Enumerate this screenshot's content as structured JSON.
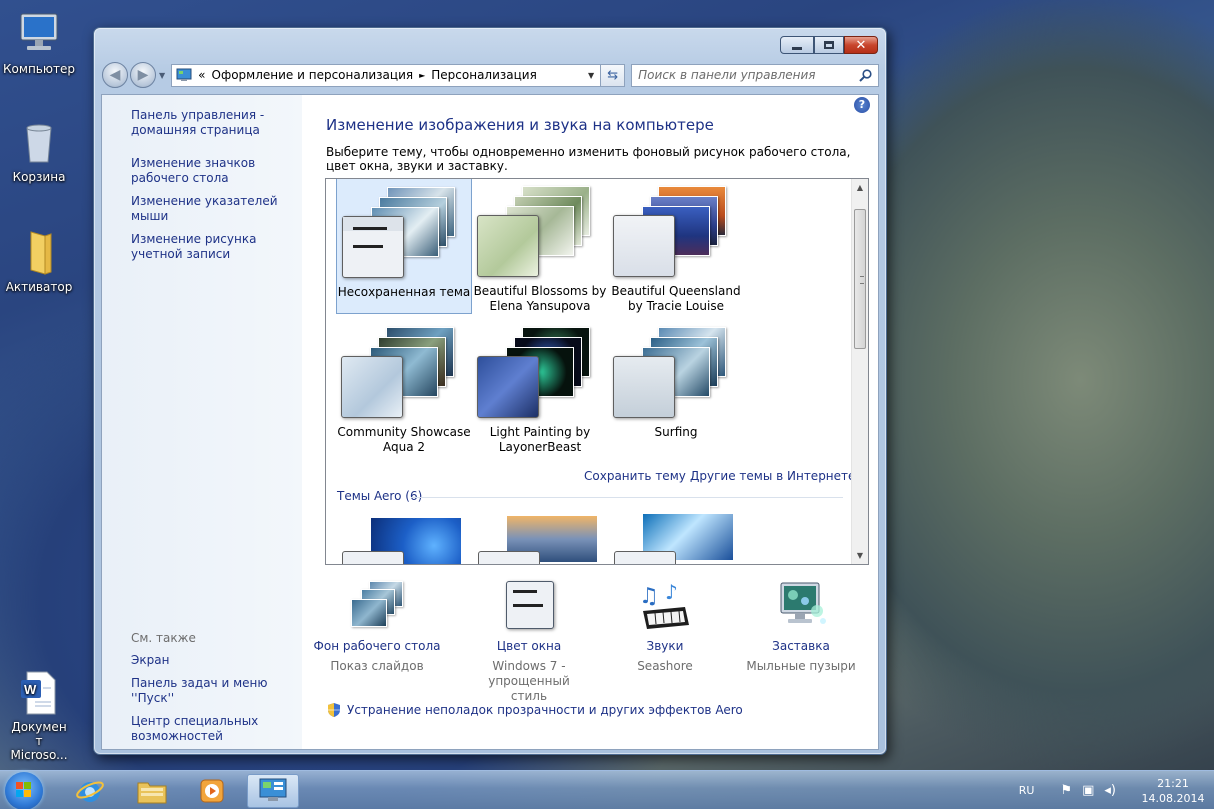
{
  "desktop": {
    "icons": [
      {
        "label": "Компьютер"
      },
      {
        "label": "Корзина"
      },
      {
        "label": "Активатор"
      },
      {
        "label": "Документ Microso..."
      }
    ]
  },
  "window": {
    "address": {
      "crumb_prefix": "«",
      "segment1": "Оформление и персонализация",
      "sep": "►",
      "segment2": "Персонализация"
    },
    "search_placeholder": "Поиск в панели управления",
    "left_pane": {
      "links": [
        "Панель управления - домашняя страница",
        "Изменение значков рабочего стола",
        "Изменение указателей мыши",
        "Изменение рисунка учетной записи"
      ],
      "see_also_header": "См. также",
      "see_also": [
        "Экран",
        "Панель задач и меню ''Пуск''",
        "Центр специальных возможностей"
      ]
    },
    "main": {
      "title": "Изменение изображения и звука на компьютере",
      "description": "Выберите тему, чтобы одновременно изменить фоновый рисунок рабочего стола, цвет окна, звуки и заставку.",
      "themes": [
        {
          "label": "Несохраненная тема",
          "selected": true
        },
        {
          "label": "Beautiful Blossoms by Elena Yansupova"
        },
        {
          "label": "Beautiful Queensland by Tracie Louise"
        },
        {
          "label": "Community Showcase Aqua 2"
        },
        {
          "label": "Light Painting by LayonerBeast"
        },
        {
          "label": "Surfing"
        }
      ],
      "save_theme": "Сохранить тему",
      "more_themes": "Другие темы в Интернете",
      "aero_section": "Темы Aero (6)",
      "bottom": [
        {
          "label": "Фон рабочего стола",
          "sub": "Показ слайдов",
          "icon": "desktop-background-icon"
        },
        {
          "label": "Цвет окна",
          "sub": "Windows 7 - упрощенный стиль",
          "icon": "window-color-icon"
        },
        {
          "label": "Звуки",
          "sub": "Seashore",
          "icon": "sounds-icon"
        },
        {
          "label": "Заставка",
          "sub": "Мыльные пузыри",
          "icon": "screensaver-icon"
        }
      ],
      "troubleshoot": "Устранение неполадок прозрачности и других эффектов Aero"
    }
  },
  "taskbar": {
    "lang": "RU",
    "time": "21:21",
    "date": "14.08.2014"
  }
}
